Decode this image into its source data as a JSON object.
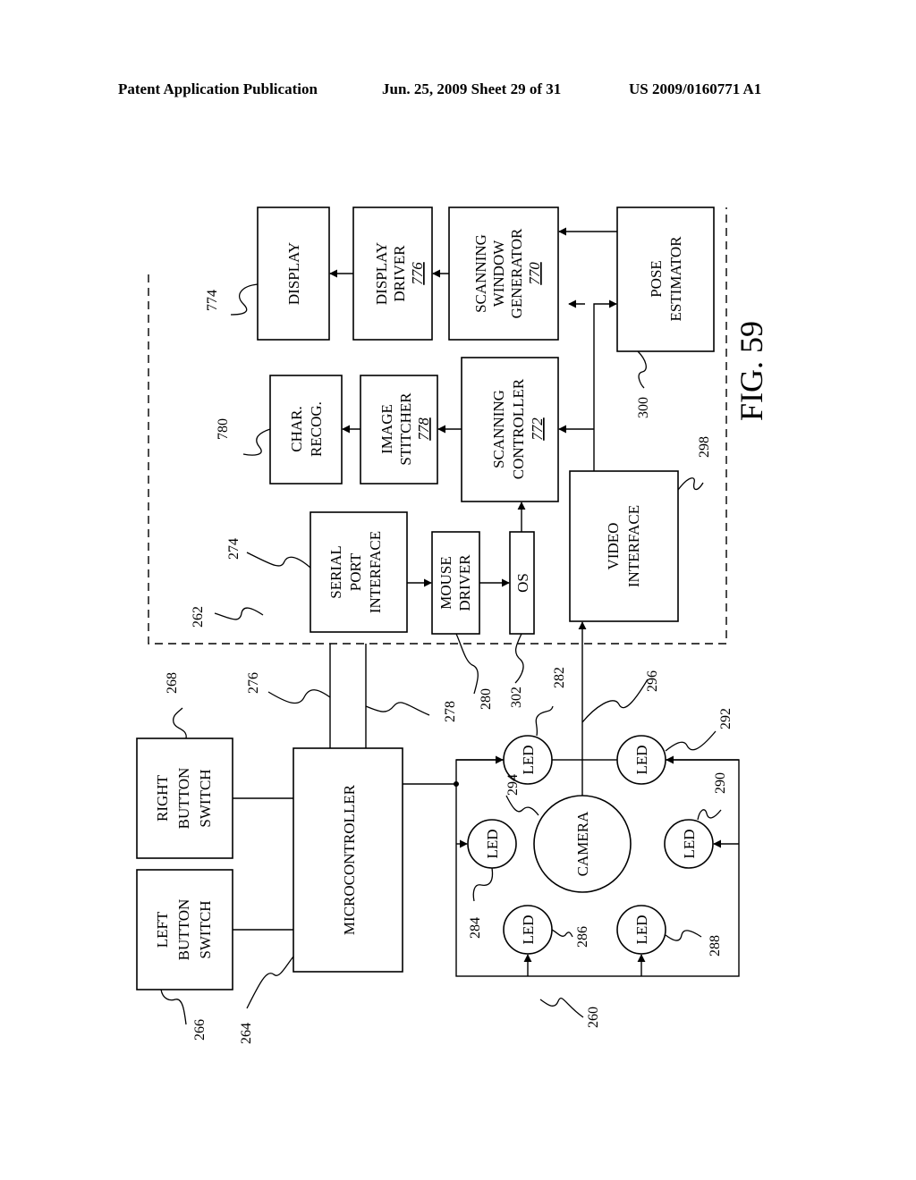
{
  "header": {
    "publication": "Patent Application Publication",
    "date_sheet": "Jun. 25, 2009  Sheet 29 of 31",
    "number": "US 2009/0160771 A1"
  },
  "figure": {
    "label": "FIG. 59",
    "orientation": "rotated 90° counter-clockwise"
  },
  "blocks": {
    "display": {
      "lines": [
        "DISPLAY"
      ],
      "ref": "774"
    },
    "display_driver": {
      "lines": [
        "DISPLAY",
        "DRIVER"
      ],
      "num": "776"
    },
    "scanning_window_generator": {
      "lines": [
        "SCANNING",
        "WINDOW",
        "GENERATOR"
      ],
      "num": "770"
    },
    "pose_estimator": {
      "lines": [
        "POSE",
        "ESTIMATOR"
      ],
      "ref": "300"
    },
    "char_recog": {
      "lines": [
        "CHAR.",
        "RECOG."
      ],
      "ref": "780"
    },
    "image_stitcher": {
      "lines": [
        "IMAGE",
        "STITCHER"
      ],
      "num": "778"
    },
    "scanning_controller": {
      "lines": [
        "SCANNING",
        "CONTROLLER"
      ],
      "num": "772"
    },
    "serial_port_interface": {
      "lines": [
        "SERIAL",
        "PORT",
        "INTERFACE"
      ],
      "ref": "274"
    },
    "mouse_driver": {
      "lines": [
        "MOUSE",
        "DRIVER"
      ],
      "ref": "280"
    },
    "os": {
      "lines": [
        "OS"
      ],
      "ref": "302"
    },
    "video_interface": {
      "lines": [
        "VIDEO",
        "INTERFACE"
      ],
      "ref": "298"
    },
    "right_button_switch": {
      "lines": [
        "RIGHT",
        "BUTTON",
        "SWITCH"
      ],
      "ref": "268"
    },
    "left_button_switch": {
      "lines": [
        "LEFT",
        "BUTTON",
        "SWITCH"
      ],
      "ref": "266"
    },
    "microcontroller": {
      "lines": [
        "MICROCONTROLLER"
      ],
      "ref": "264"
    },
    "camera": {
      "lines": [
        "CAMERA"
      ],
      "ref": "294"
    }
  },
  "leds": [
    {
      "label": "LED",
      "ref": "282"
    },
    {
      "label": "LED",
      "ref": "284"
    },
    {
      "label": "LED",
      "ref": "286"
    },
    {
      "label": "LED",
      "ref": "288"
    },
    {
      "label": "LED",
      "ref": "290"
    },
    {
      "label": "LED",
      "ref": "292"
    }
  ],
  "refs": {
    "computer_group": "262",
    "mouse_device": "260",
    "line_a": "276",
    "line_b": "278",
    "video_line": "296"
  }
}
